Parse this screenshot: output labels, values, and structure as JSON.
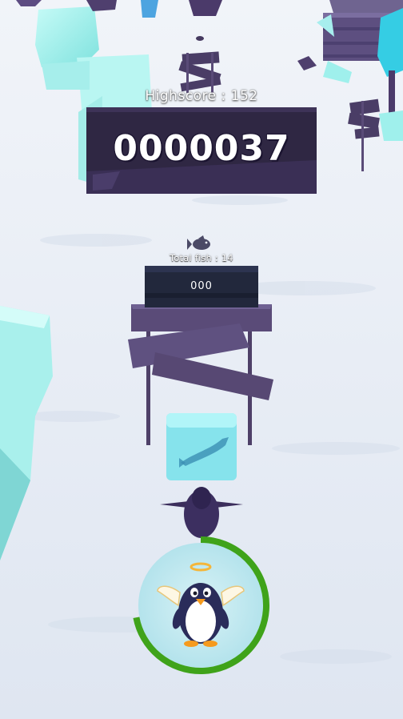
{
  "hud": {
    "highscore_label": "Highscore : 152",
    "score": "0000037",
    "fish_label": "Total fish : 14",
    "fish_count": "000"
  },
  "ability": {
    "icon": "angel-penguin-icon",
    "progress": 0.72,
    "ring_color": "#3fa31a"
  },
  "colors": {
    "snow": "#e9eef6",
    "ice": "#9ff0ec",
    "board": "#2f2743",
    "wood": "#5a4b78"
  }
}
